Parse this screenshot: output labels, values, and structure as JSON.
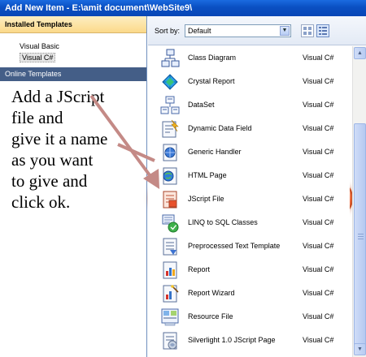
{
  "window": {
    "title": "Add New Item - E:\\amit document\\WebSite9\\"
  },
  "sidebar": {
    "installed_header": "Installed Templates",
    "items": [
      {
        "label": "Visual Basic"
      },
      {
        "label": "Visual C#"
      }
    ],
    "online_header": "Online Templates"
  },
  "annotation": {
    "text": "Add a JScript\nfile and\ngive it a name\nas you want\nto give and\nclick ok.",
    "arrow_color": "#c48a86"
  },
  "toolbar": {
    "sortby_label": "Sort by:",
    "sortby_value": "Default"
  },
  "templates": [
    {
      "name": "Class Diagram",
      "lang": "Visual C#",
      "icon": "class-diagram-icon"
    },
    {
      "name": "Crystal Report",
      "lang": "Visual C#",
      "icon": "crystal-report-icon"
    },
    {
      "name": "DataSet",
      "lang": "Visual C#",
      "icon": "dataset-icon"
    },
    {
      "name": "Dynamic Data Field",
      "lang": "Visual C#",
      "icon": "dynamic-data-field-icon"
    },
    {
      "name": "Generic Handler",
      "lang": "Visual C#",
      "icon": "generic-handler-icon"
    },
    {
      "name": "HTML Page",
      "lang": "Visual C#",
      "icon": "html-page-icon"
    },
    {
      "name": "JScript File",
      "lang": "Visual C#",
      "icon": "jscript-file-icon"
    },
    {
      "name": "LINQ to SQL Classes",
      "lang": "Visual C#",
      "icon": "linq-to-sql-icon"
    },
    {
      "name": "Preprocessed Text Template",
      "lang": "Visual C#",
      "icon": "text-template-icon"
    },
    {
      "name": "Report",
      "lang": "Visual C#",
      "icon": "report-icon"
    },
    {
      "name": "Report Wizard",
      "lang": "Visual C#",
      "icon": "report-wizard-icon"
    },
    {
      "name": "Resource File",
      "lang": "Visual C#",
      "icon": "resource-file-icon"
    },
    {
      "name": "Silverlight 1.0 JScript Page",
      "lang": "Visual C#",
      "icon": "silverlight-page-icon"
    }
  ],
  "colors": {
    "title_bar": "#0a4fc2",
    "highlight": "#ee6a3a",
    "online_header": "#445e87"
  }
}
